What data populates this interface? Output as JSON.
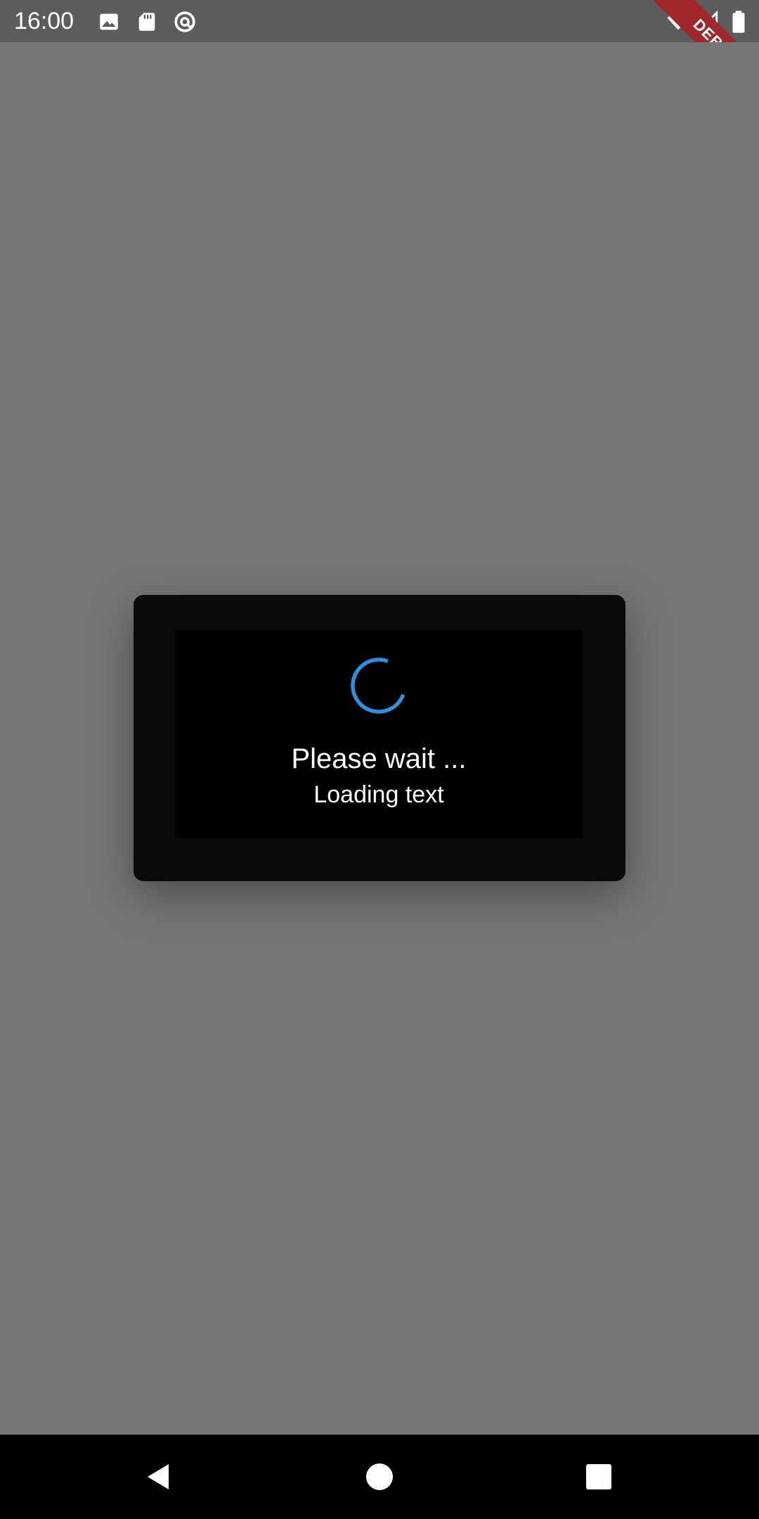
{
  "status_bar": {
    "time": "16:00",
    "icons": [
      "image-icon",
      "sd-card-icon",
      "at-sign-icon",
      "wifi-icon",
      "signal-icon",
      "battery-icon"
    ],
    "debug_banner": "DEBUG"
  },
  "dialog": {
    "title": "Please wait ...",
    "message": "Loading text",
    "spinner_color": "#2f8fe0"
  },
  "nav_bar": {
    "buttons": [
      "back-button",
      "home-button",
      "recents-button"
    ]
  },
  "colors": {
    "scrim": "#767677",
    "dialog_bg": "#0b0b0c",
    "debug_banner": "#a0282c"
  }
}
